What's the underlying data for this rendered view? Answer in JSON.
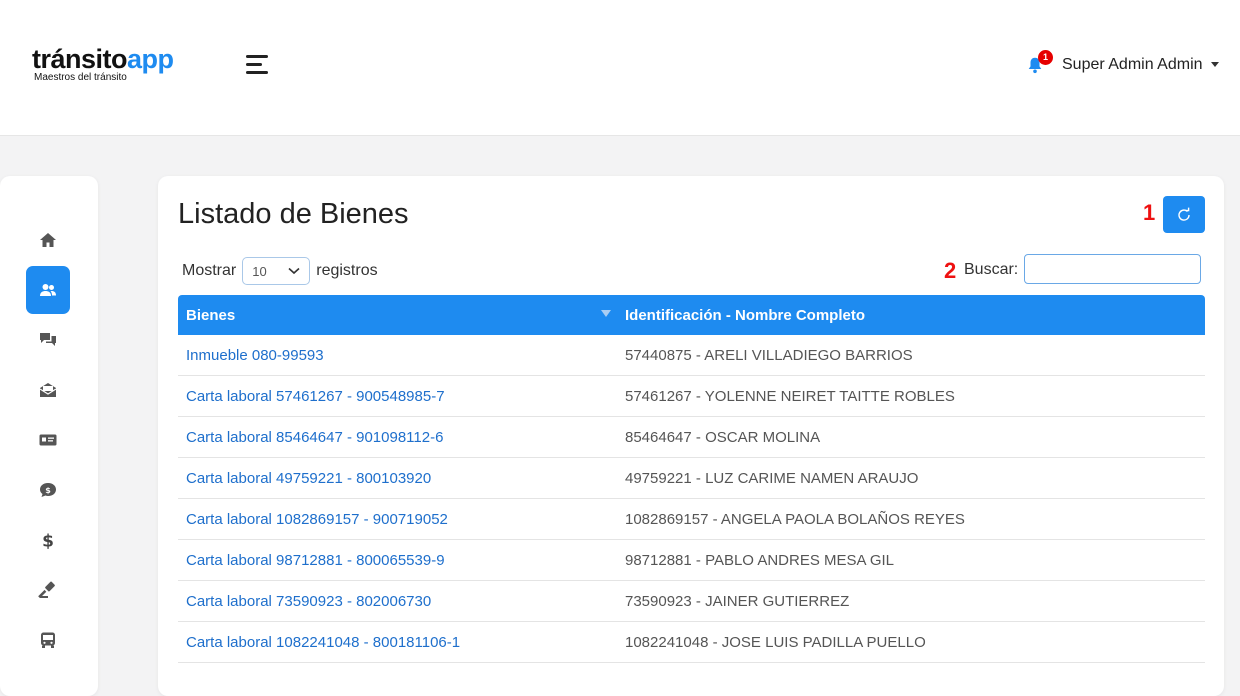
{
  "header": {
    "logo": {
      "dark": "tránsito",
      "blue": "app",
      "tagline": "Maestros del tránsito"
    },
    "notification_count": "1",
    "user_name": "Super Admin Admin"
  },
  "sidebar": {
    "items": [
      {
        "icon": "home-icon",
        "active": false
      },
      {
        "icon": "users-icon",
        "active": true
      },
      {
        "icon": "comments-icon",
        "active": false
      },
      {
        "icon": "envelope-open-icon",
        "active": false
      },
      {
        "icon": "id-card-icon",
        "active": false
      },
      {
        "icon": "money-comment-icon",
        "active": false
      },
      {
        "icon": "dollar-icon",
        "active": false
      },
      {
        "icon": "gavel-icon",
        "active": false
      },
      {
        "icon": "bus-icon",
        "active": false
      }
    ]
  },
  "main": {
    "title": "Listado de Bienes",
    "marker_1": "1",
    "marker_2": "2",
    "show_label": "Mostrar",
    "show_value": "10",
    "records_label": "registros",
    "search_label": "Buscar:",
    "search_value": "",
    "columns": [
      "Bienes",
      "Identificación - Nombre Completo"
    ],
    "rows": [
      {
        "bien": "Inmueble 080-99593",
        "persona": "57440875 - ARELI VILLADIEGO BARRIOS"
      },
      {
        "bien": "Carta laboral 57461267 - 900548985-7",
        "persona": "57461267 - YOLENNE NEIRET TAITTE ROBLES"
      },
      {
        "bien": "Carta laboral 85464647 - 901098112-6",
        "persona": "85464647 - OSCAR MOLINA"
      },
      {
        "bien": "Carta laboral 49759221 - 800103920",
        "persona": "49759221 - LUZ CARIME NAMEN ARAUJO"
      },
      {
        "bien": "Carta laboral 1082869157 - 900719052",
        "persona": "1082869157 - ANGELA PAOLA BOLAÑOS REYES"
      },
      {
        "bien": "Carta laboral 98712881 - 800065539-9",
        "persona": "98712881 - PABLO ANDRES MESA GIL"
      },
      {
        "bien": "Carta laboral 73590923 - 802006730",
        "persona": "73590923 - JAINER GUTIERREZ"
      },
      {
        "bien": "Carta laboral 1082241048 - 800181106-1",
        "persona": "1082241048 - JOSE LUIS PADILLA PUELLO"
      }
    ]
  },
  "colors": {
    "accent": "#1e8bf0",
    "link": "#1e6fcc",
    "marker": "#e11111"
  }
}
